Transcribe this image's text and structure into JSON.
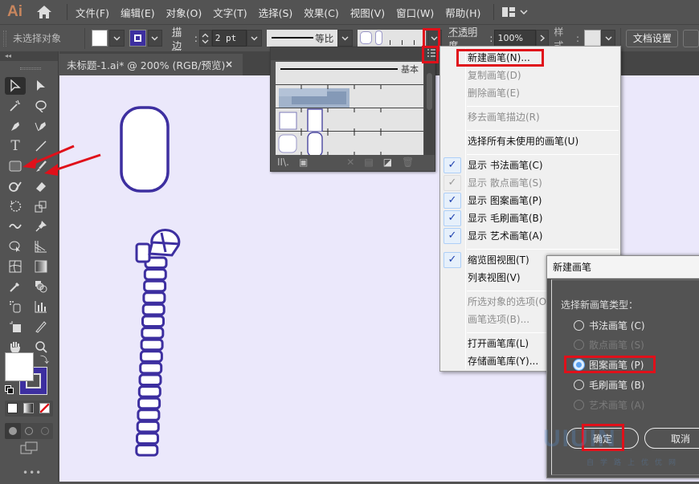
{
  "app": {
    "logo": "Ai"
  },
  "menubar": {
    "items": [
      "文件(F)",
      "编辑(E)",
      "对象(O)",
      "文字(T)",
      "选择(S)",
      "效果(C)",
      "视图(V)",
      "窗口(W)",
      "帮助(H)"
    ]
  },
  "control_bar": {
    "selection_status": "未选择对象",
    "stroke_label": "描边",
    "stroke_weight": "2 pt",
    "stroke_profile": "等比",
    "opacity_label": "不透明度",
    "opacity_value": "100%",
    "style_label": "样式",
    "doc_setup_button": "文档设置",
    "stroke_color": "#3d2fa0",
    "fill_color": "#ffffff"
  },
  "document_tab": {
    "title": "未标题-1.ai* @ 200% (RGB/预览)",
    "close": "×"
  },
  "tools_panel": {
    "collapse": "◂◂"
  },
  "brushes_panel": {
    "basic_label": "基本"
  },
  "context_menu": {
    "items": [
      {
        "label": "新建画笔(N)...",
        "enabled": true,
        "highlighted": true
      },
      {
        "label": "复制画笔(D)",
        "enabled": false
      },
      {
        "label": "删除画笔(E)",
        "enabled": false
      },
      {
        "label": "移去画笔描边(R)",
        "enabled": false
      },
      {
        "label": "选择所有未使用的画笔(U)",
        "enabled": true
      },
      {
        "label": "显示 书法画笔(C)",
        "enabled": true,
        "checked": true
      },
      {
        "label": "显示 散点画笔(S)",
        "enabled": false,
        "checked": true
      },
      {
        "label": "显示 图案画笔(P)",
        "enabled": true,
        "checked": true
      },
      {
        "label": "显示 毛刷画笔(B)",
        "enabled": true,
        "checked": true
      },
      {
        "label": "显示 艺术画笔(A)",
        "enabled": true,
        "checked": true
      },
      {
        "label": "缩览图视图(T)",
        "enabled": true,
        "checked": true
      },
      {
        "label": "列表视图(V)",
        "enabled": true
      },
      {
        "label": "所选对象的选项(O)...",
        "enabled": false
      },
      {
        "label": "画笔选项(B)...",
        "enabled": false
      },
      {
        "label": "打开画笔库(L)",
        "enabled": true
      },
      {
        "label": "存储画笔库(Y)...",
        "enabled": true
      }
    ],
    "check_glyph": "✓"
  },
  "dialog": {
    "title": "新建画笔",
    "prompt": "选择新画笔类型：",
    "options": [
      {
        "label": "书法画笔 (C)",
        "enabled": true,
        "selected": false
      },
      {
        "label": "散点画笔 (S)",
        "enabled": false,
        "selected": false
      },
      {
        "label": "图案画笔 (P)",
        "enabled": true,
        "selected": true
      },
      {
        "label": "毛刷画笔 (B)",
        "enabled": true,
        "selected": false
      },
      {
        "label": "艺术画笔 (A)",
        "enabled": false,
        "selected": false
      }
    ],
    "ok_button": "确定",
    "cancel_button": "取消"
  },
  "watermark": {
    "text": "UIUIN",
    "sub": "自学路上优优网"
  },
  "colors": {
    "accent_red": "#e0101a",
    "shape_stroke": "#3d2fa0",
    "canvas_bg": "#ebe8fb"
  }
}
